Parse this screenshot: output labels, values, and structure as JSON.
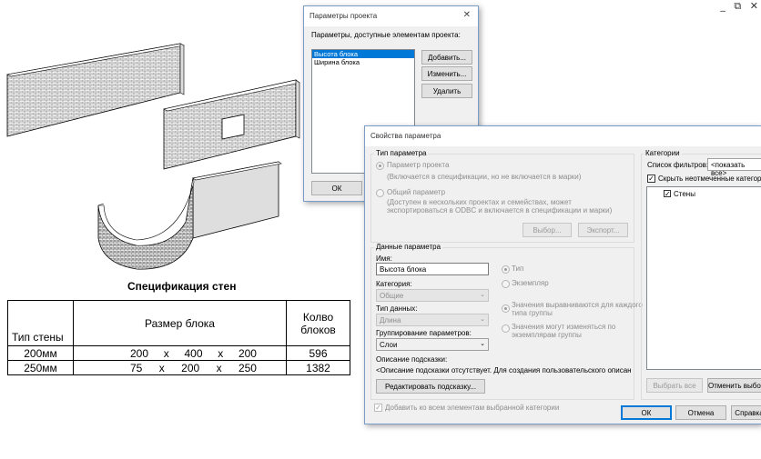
{
  "window_icons": "_ ⧉ ✕",
  "schedule": {
    "title": "Спецификация стен",
    "headers": {
      "type": "Тип стены",
      "size": "Размер блока",
      "count": "Колво блоков"
    },
    "rows": [
      {
        "type": "200мм",
        "d1": "200",
        "d2": "400",
        "d3": "200",
        "count": "596"
      },
      {
        "type": "250мм",
        "d1": "75",
        "d2": "200",
        "d3": "250",
        "count": "1382"
      }
    ],
    "sep": "x"
  },
  "project_params": {
    "title": "Параметры проекта",
    "list_label": "Параметры, доступные элементам проекта:",
    "items": [
      "Высота блока",
      "Ширина блока"
    ],
    "add": "Добавить...",
    "edit": "Изменить...",
    "delete": "Удалить",
    "ok": "ОК"
  },
  "param_props": {
    "title": "Свойства параметра",
    "type_group": "Тип параметра",
    "project_param": "Параметр проекта",
    "project_param_desc": "(Включается в спецификации, но не включается в марки)",
    "shared_param": "Общий параметр",
    "shared_param_desc1": "(Доступен в нескольких проектах и семействах, может",
    "shared_param_desc2": "экспортироваться в ODBC и включается в спецификации и марки)",
    "choose": "Выбор...",
    "export": "Экспорт...",
    "data_group": "Данные параметра",
    "name_label": "Имя:",
    "name_value": "Высота блока",
    "type_radio": "Тип",
    "instance_radio": "Экземпляр",
    "category_label": "Категория:",
    "category_value": "Общие",
    "datatype_label": "Тип данных:",
    "datatype_value": "Длина",
    "values_aligned1": "Значения выравниваются для каждого",
    "values_aligned2": "типа группы",
    "values_vary1": "Значения могут изменяться по",
    "values_vary2": "экземплярам группы",
    "grouping_label": "Группирование параметров:",
    "grouping_value": "Слои",
    "tooltip_label": "Описание подсказки:",
    "tooltip_value": "<Описание подсказки отсутствует. Для создания пользовательского описания отр...",
    "edit_tooltip": "Редактировать подсказку...",
    "categories_group": "Категории",
    "filter_label": "Список фильтров:",
    "filter_value": "<показать все>",
    "hide_unchecked": "Скрыть неотмеченные категории",
    "tree_item": "Стены",
    "select_all": "Выбрать все",
    "deselect_all": "Отменить выбор",
    "add_all": "Добавить ко всем элементам выбранной категории",
    "ok": "ОК",
    "cancel": "Отмена",
    "help": "Справка"
  }
}
